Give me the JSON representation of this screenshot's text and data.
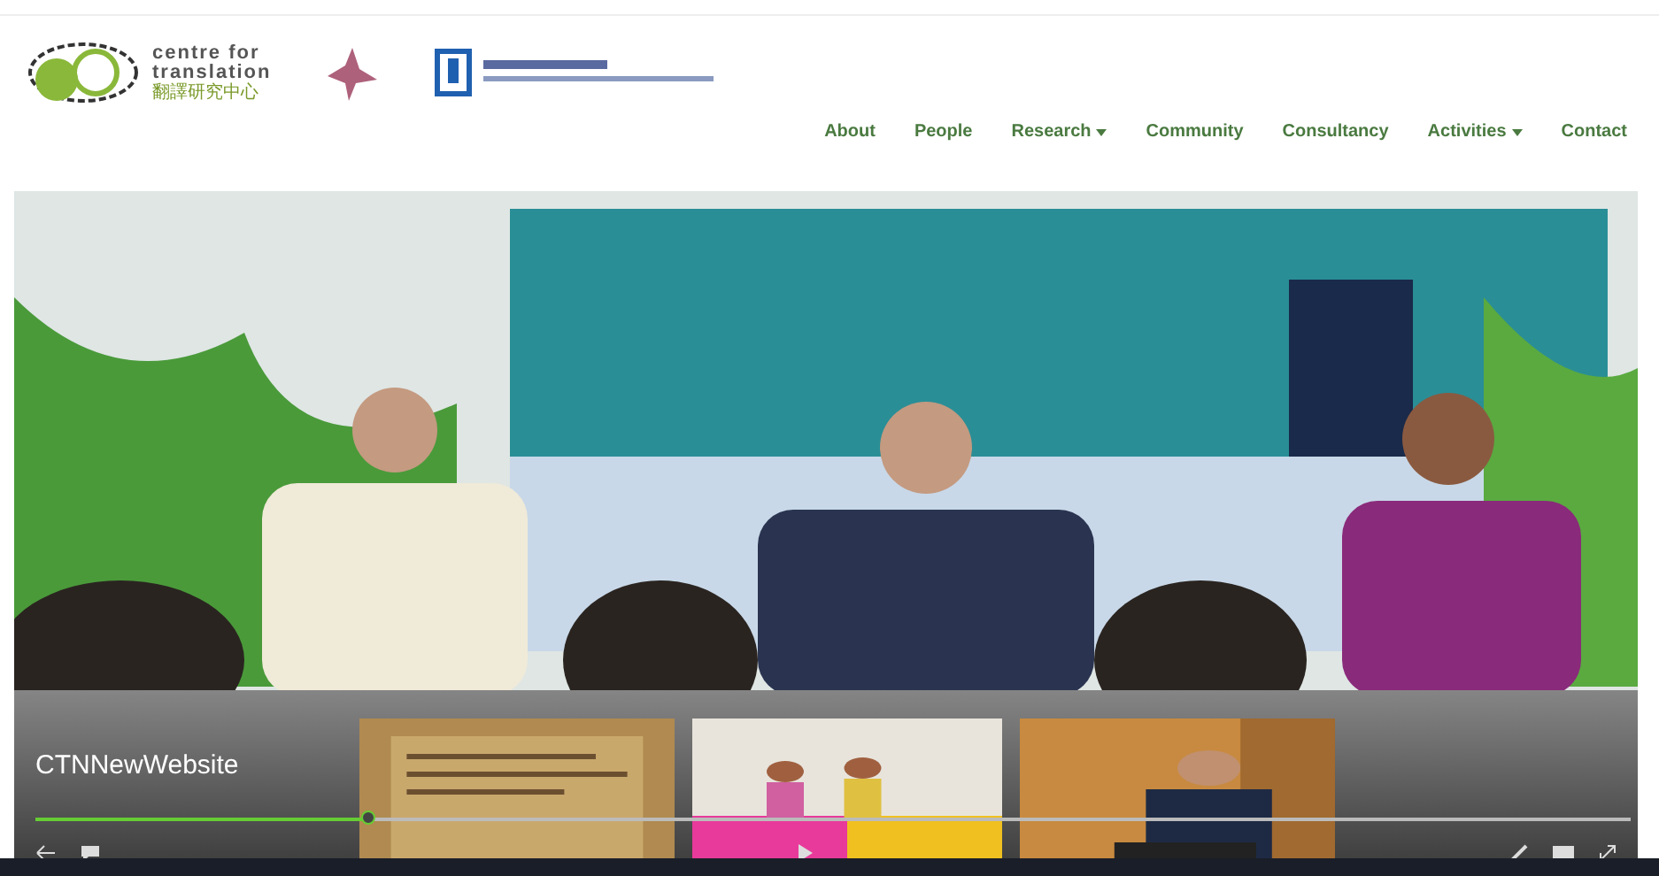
{
  "logo": {
    "line_1": "centre for",
    "line_2": "translation",
    "line_3": "翻譯研究中心"
  },
  "nav": [
    {
      "label": "About",
      "has_menu": false
    },
    {
      "label": "People",
      "has_menu": false
    },
    {
      "label": "Research",
      "has_menu": true
    },
    {
      "label": "Community",
      "has_menu": false
    },
    {
      "label": "Consultancy",
      "has_menu": false
    },
    {
      "label": "Activities",
      "has_menu": true
    },
    {
      "label": "Contact",
      "has_menu": false
    }
  ],
  "player": {
    "title": "CTNNewWebsite",
    "level": 0.21,
    "thumbnails": [
      {
        "kind": "picture"
      },
      {
        "kind": "picture"
      },
      {
        "kind": "picture"
      }
    ]
  }
}
